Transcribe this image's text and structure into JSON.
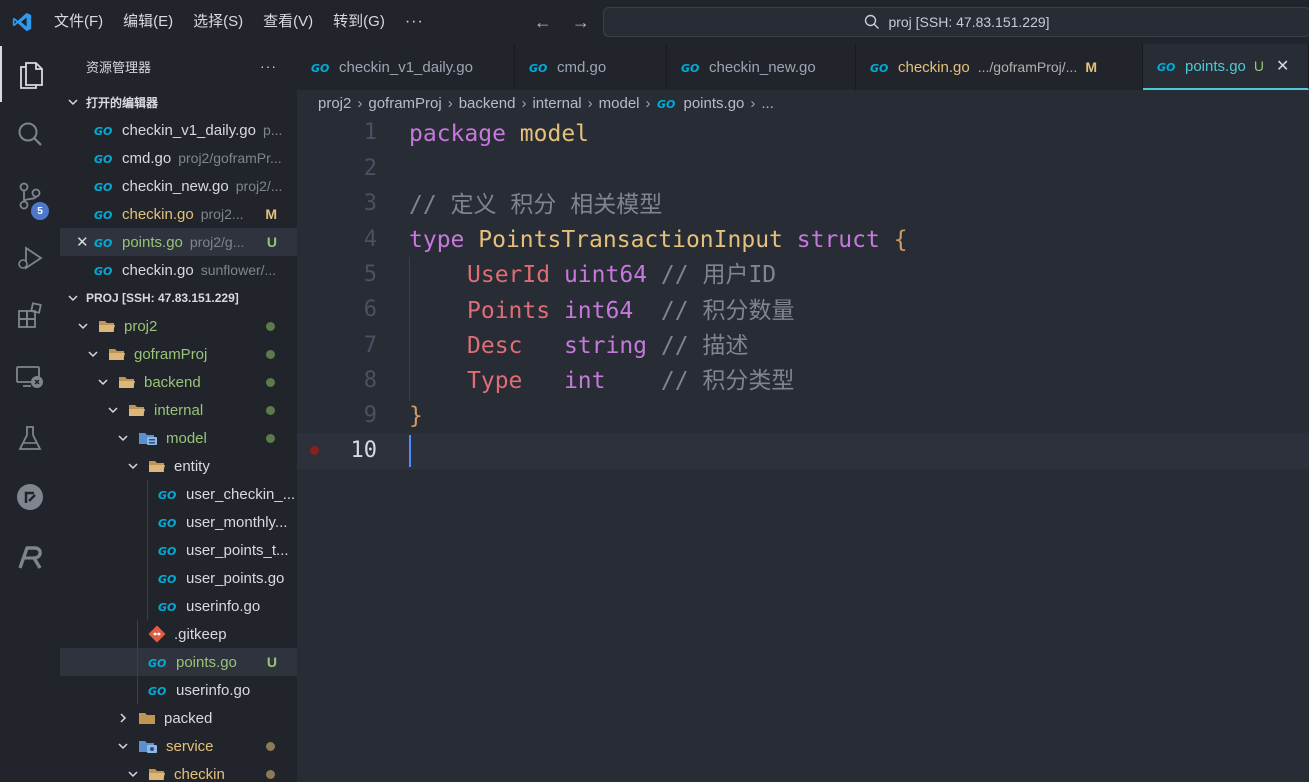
{
  "titlebar": {
    "menus": [
      "文件(F)",
      "编辑(E)",
      "选择(S)",
      "查看(V)",
      "转到(G)"
    ],
    "more": "···",
    "search_text": "proj [SSH: 47.83.151.229]"
  },
  "activity": {
    "scm_badge": "5"
  },
  "sidebar": {
    "title": "资源管理器",
    "more": "···",
    "open_editors_label": "打开的编辑器",
    "open_editors": [
      {
        "name": "checkin_v1_daily.go",
        "path": "p...",
        "status": "",
        "close": ""
      },
      {
        "name": "cmd.go",
        "path": "proj2/goframPr...",
        "status": "",
        "close": ""
      },
      {
        "name": "checkin_new.go",
        "path": "proj2/...",
        "status": "",
        "close": ""
      },
      {
        "name": "checkin.go",
        "path": "proj2...",
        "status": "M",
        "close": ""
      },
      {
        "name": "points.go",
        "path": "proj2/g...",
        "status": "U",
        "close": "✕"
      },
      {
        "name": "checkin.go",
        "path": "sunflower/...",
        "status": "",
        "close": ""
      }
    ],
    "workspace_label": "PROJ [SSH: 47.83.151.229]",
    "tree": [
      {
        "name": "proj2"
      },
      {
        "name": "goframProj"
      },
      {
        "name": "backend"
      },
      {
        "name": "internal"
      },
      {
        "name": "model"
      },
      {
        "name": "entity"
      },
      {
        "name": "user_checkin_..."
      },
      {
        "name": "user_monthly..."
      },
      {
        "name": "user_points_t..."
      },
      {
        "name": "user_points.go"
      },
      {
        "name": "userinfo.go"
      },
      {
        "name": ".gitkeep"
      },
      {
        "name": "points.go",
        "status": "U"
      },
      {
        "name": "userinfo.go"
      },
      {
        "name": "packed"
      },
      {
        "name": "service"
      },
      {
        "name": "checkin"
      }
    ]
  },
  "tabs": [
    {
      "name": "checkin_v1_daily.go",
      "extra": "",
      "status": ""
    },
    {
      "name": "cmd.go",
      "extra": "",
      "status": ""
    },
    {
      "name": "checkin_new.go",
      "extra": "",
      "status": ""
    },
    {
      "name": "checkin.go",
      "extra": ".../goframProj/...",
      "status": "M"
    },
    {
      "name": "points.go",
      "extra": "",
      "status": "U",
      "close": "✕"
    }
  ],
  "breadcrumb": [
    "proj2",
    "goframProj",
    "backend",
    "internal",
    "model",
    "points.go",
    "..."
  ],
  "editor": {
    "line_numbers": [
      "1",
      "2",
      "3",
      "4",
      "5",
      "6",
      "7",
      "8",
      "9",
      "10"
    ],
    "code": {
      "l1_kw": "package",
      "l1_name": "model",
      "l3_comment": "// 定义 积分 相关模型",
      "l4_kw": "type",
      "l4_type": "PointsTransactionInput",
      "l4_kw2": "struct",
      "l4_brace": "{",
      "l5_field": "UserId",
      "l5_type": "uint64",
      "l5_comment": "// 用户ID",
      "l6_field": "Points",
      "l6_type": "int64",
      "l6_comment": "// 积分数量",
      "l7_field": "Desc",
      "l7_type": "string",
      "l7_comment": "// 描述",
      "l8_field": "Type",
      "l8_type": "int",
      "l8_comment": "// 积分类型",
      "l9_brace": "}"
    }
  },
  "colors": {
    "accent": "#4ec9d8",
    "modified": "#e5c07b",
    "untracked": "#98c379",
    "badge": "#4d78cc"
  }
}
